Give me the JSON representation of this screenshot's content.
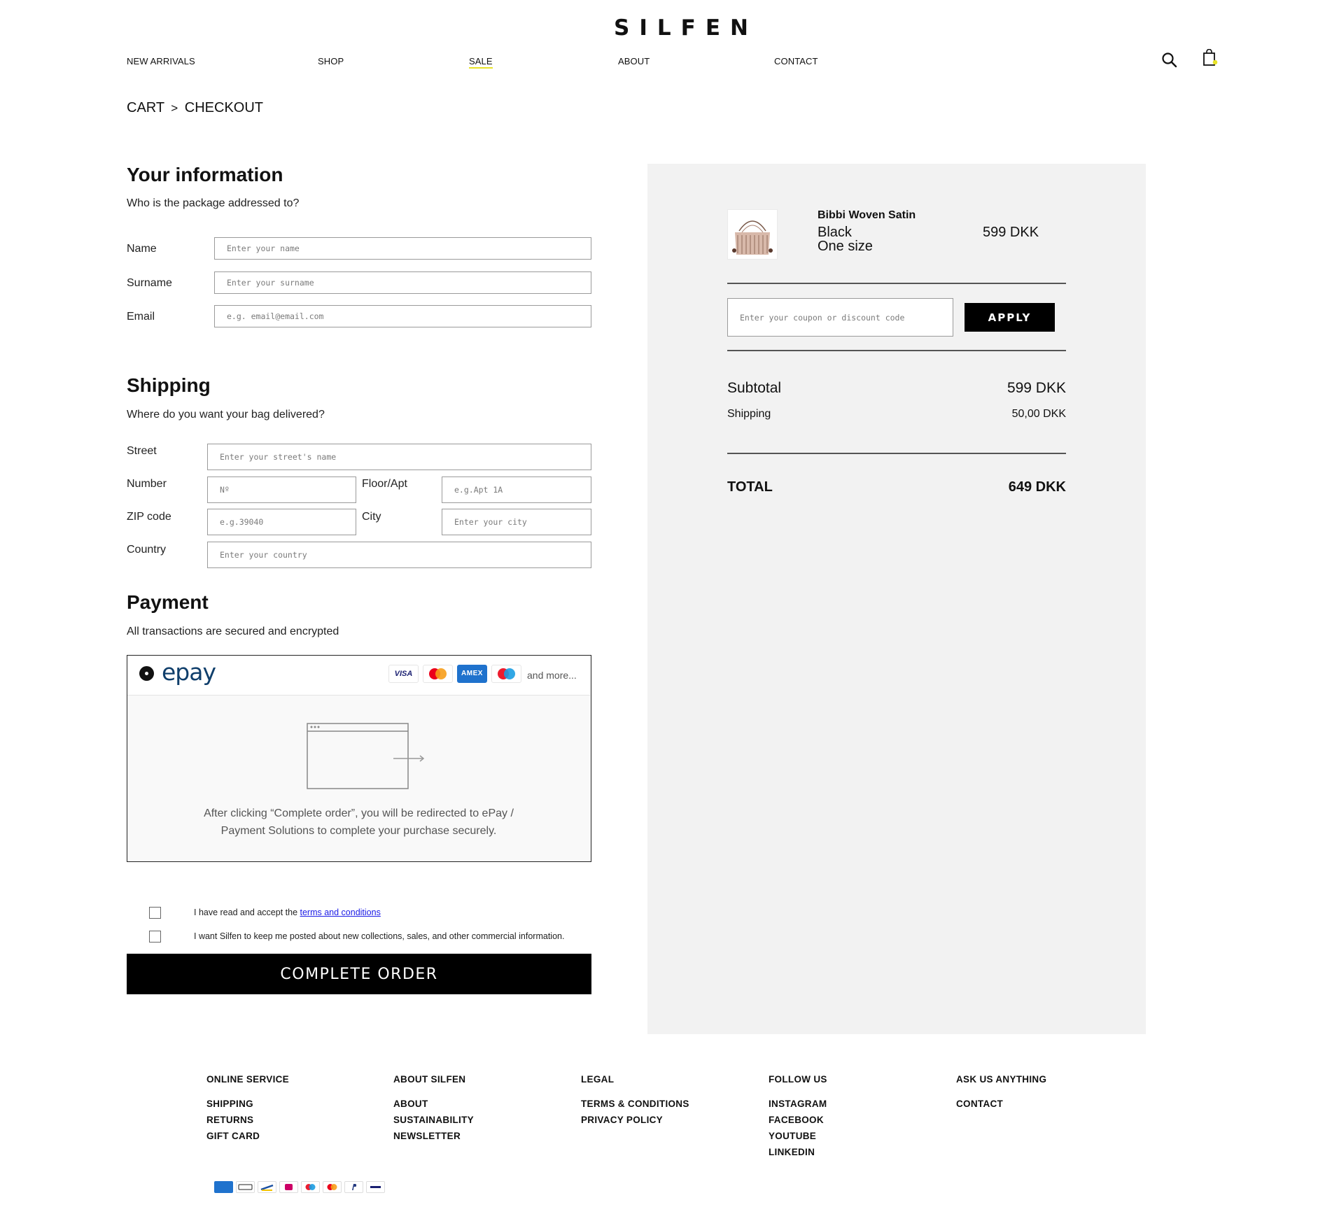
{
  "header": {
    "logo": "SILFEN",
    "nav": [
      "NEW ARRIVALS",
      "SHOP",
      "SALE",
      "ABOUT",
      "CONTACT"
    ]
  },
  "breadcrumb": {
    "cart": "CART",
    "separator": ">",
    "checkout": "CHECKOUT"
  },
  "info": {
    "title": "Your information",
    "subtitle": "Who is the package addressed to?",
    "name_label": "Name",
    "name_placeholder": "Enter your name",
    "surname_label": "Surname",
    "surname_placeholder": "Enter your surname",
    "email_label": "Email",
    "email_placeholder": "e.g. email@email.com"
  },
  "shipping": {
    "title": "Shipping",
    "subtitle": "Where do you want your bag delivered?",
    "street_label": "Street",
    "street_placeholder": "Enter your street's name",
    "number_label": "Number",
    "number_placeholder": "Nº",
    "floor_label": "Floor/Apt",
    "floor_placeholder": "e.g.Apt 1A",
    "zip_label": "ZIP code",
    "zip_placeholder": "e.g.39040",
    "city_label": "City",
    "city_placeholder": "Enter your city",
    "country_label": "Country",
    "country_placeholder": "Enter your country"
  },
  "payment": {
    "title": "Payment",
    "subtitle": "All transactions are secured and encrypted",
    "provider": "epay",
    "cards": {
      "visa": "VISA",
      "amex": "AMEX"
    },
    "and_more": "and more...",
    "redirect_line1": "After clicking “Complete order”, you will be redirected to ePay /",
    "redirect_line2": "Payment Solutions to complete your purchase securely."
  },
  "consent": {
    "terms_prefix": "I have read and accept the ",
    "terms_link": "terms and conditions",
    "newsletter": "I want Silfen to keep me posted about new collections, sales, and other commercial information."
  },
  "complete_button": "COMPLETE ORDER",
  "summary": {
    "product_name": "Bibbi Woven Satin",
    "color": "Black",
    "size": "One size",
    "price": "599 DKK",
    "coupon_placeholder": "Enter your coupon or discount code",
    "apply": "APPLY",
    "subtotal_label": "Subtotal",
    "subtotal_value": "599 DKK",
    "shipping_label": "Shipping",
    "shipping_value": "50,00 DKK",
    "total_label": "TOTAL",
    "total_value": "649 DKK"
  },
  "footer": {
    "columns": [
      {
        "title": "ONLINE SERVICE",
        "links": [
          "SHIPPING",
          "RETURNS",
          "GIFT CARD"
        ]
      },
      {
        "title": "ABOUT SILFEN",
        "links": [
          "ABOUT",
          "SUSTAINABILITY",
          "NEWSLETTER"
        ]
      },
      {
        "title": "LEGAL",
        "links": [
          "TERMS & CONDITIONS",
          "PRIVACY POLICY"
        ]
      },
      {
        "title": "FOLLOW US",
        "links": [
          "INSTAGRAM",
          "FACEBOOK",
          "YOUTUBE",
          "LINKEDIN"
        ]
      },
      {
        "title": "ASK US ANYTHING",
        "links": [
          "CONTACT"
        ]
      }
    ],
    "payment_icons": [
      "amex-icon",
      "apple-pay-icon",
      "bank-transfer-icon",
      "ideal-icon",
      "maestro-icon",
      "mastercard-icon",
      "paypal-icon",
      "visa-icon"
    ]
  },
  "colors": {
    "sale_underline": "#e8e327",
    "summary_bg": "#f2f2f2",
    "epay_blue": "#0f3e6b",
    "link_blue": "#1a1ae6"
  }
}
